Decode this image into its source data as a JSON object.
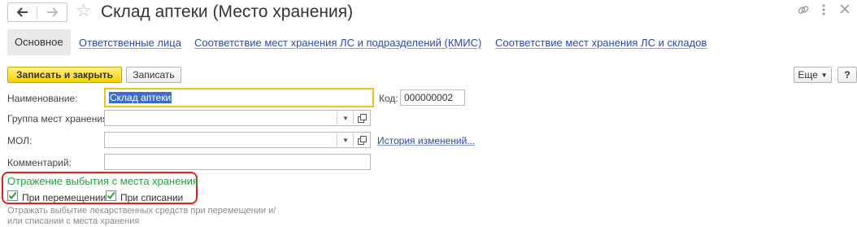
{
  "header": {
    "title": "Склад аптеки (Место хранения)",
    "back_icon": "arrow-left-icon",
    "forward_icon": "arrow-right-icon",
    "favorite_icon": "star-icon",
    "link_icon": "link-icon",
    "menu_icon": "more-vertical-icon",
    "close_icon": "close-icon"
  },
  "tabs": [
    {
      "label": "Основное",
      "active": true
    },
    {
      "label": "Ответственные лица"
    },
    {
      "label": "Соответствие мест хранения ЛС и подразделений (КМИС)"
    },
    {
      "label": "Соответствие мест хранения ЛС и складов"
    }
  ],
  "toolbar": {
    "save_close_label": "Записать и закрыть",
    "save_label": "Записать",
    "more_label": "Еще",
    "help_label": "?"
  },
  "form": {
    "name_label": "Наименование:",
    "name_value": "Склад аптеки",
    "code_label": "Код:",
    "code_value": "000000002",
    "group_label": "Группа мест хранения:",
    "group_value": "",
    "mol_label": "МОЛ:",
    "mol_value": "",
    "history_link": "История изменений...",
    "comment_label": "Комментарий:",
    "comment_value": ""
  },
  "write_off_group": {
    "title": "Отражение выбытия с места хранения",
    "transfer_label": "При перемещении",
    "transfer_checked": true,
    "writeoff_label": "При списании",
    "writeoff_checked": true,
    "hint": "Отражать выбытие лекарственных средств при перемещении и/или списании с места хранения"
  },
  "colors": {
    "accent_yellow": "#f5d100",
    "link_blue": "#2e4aa5",
    "group_title_green": "#26a044",
    "highlight_red": "#e02020",
    "check_green": "#2a9d3c"
  }
}
